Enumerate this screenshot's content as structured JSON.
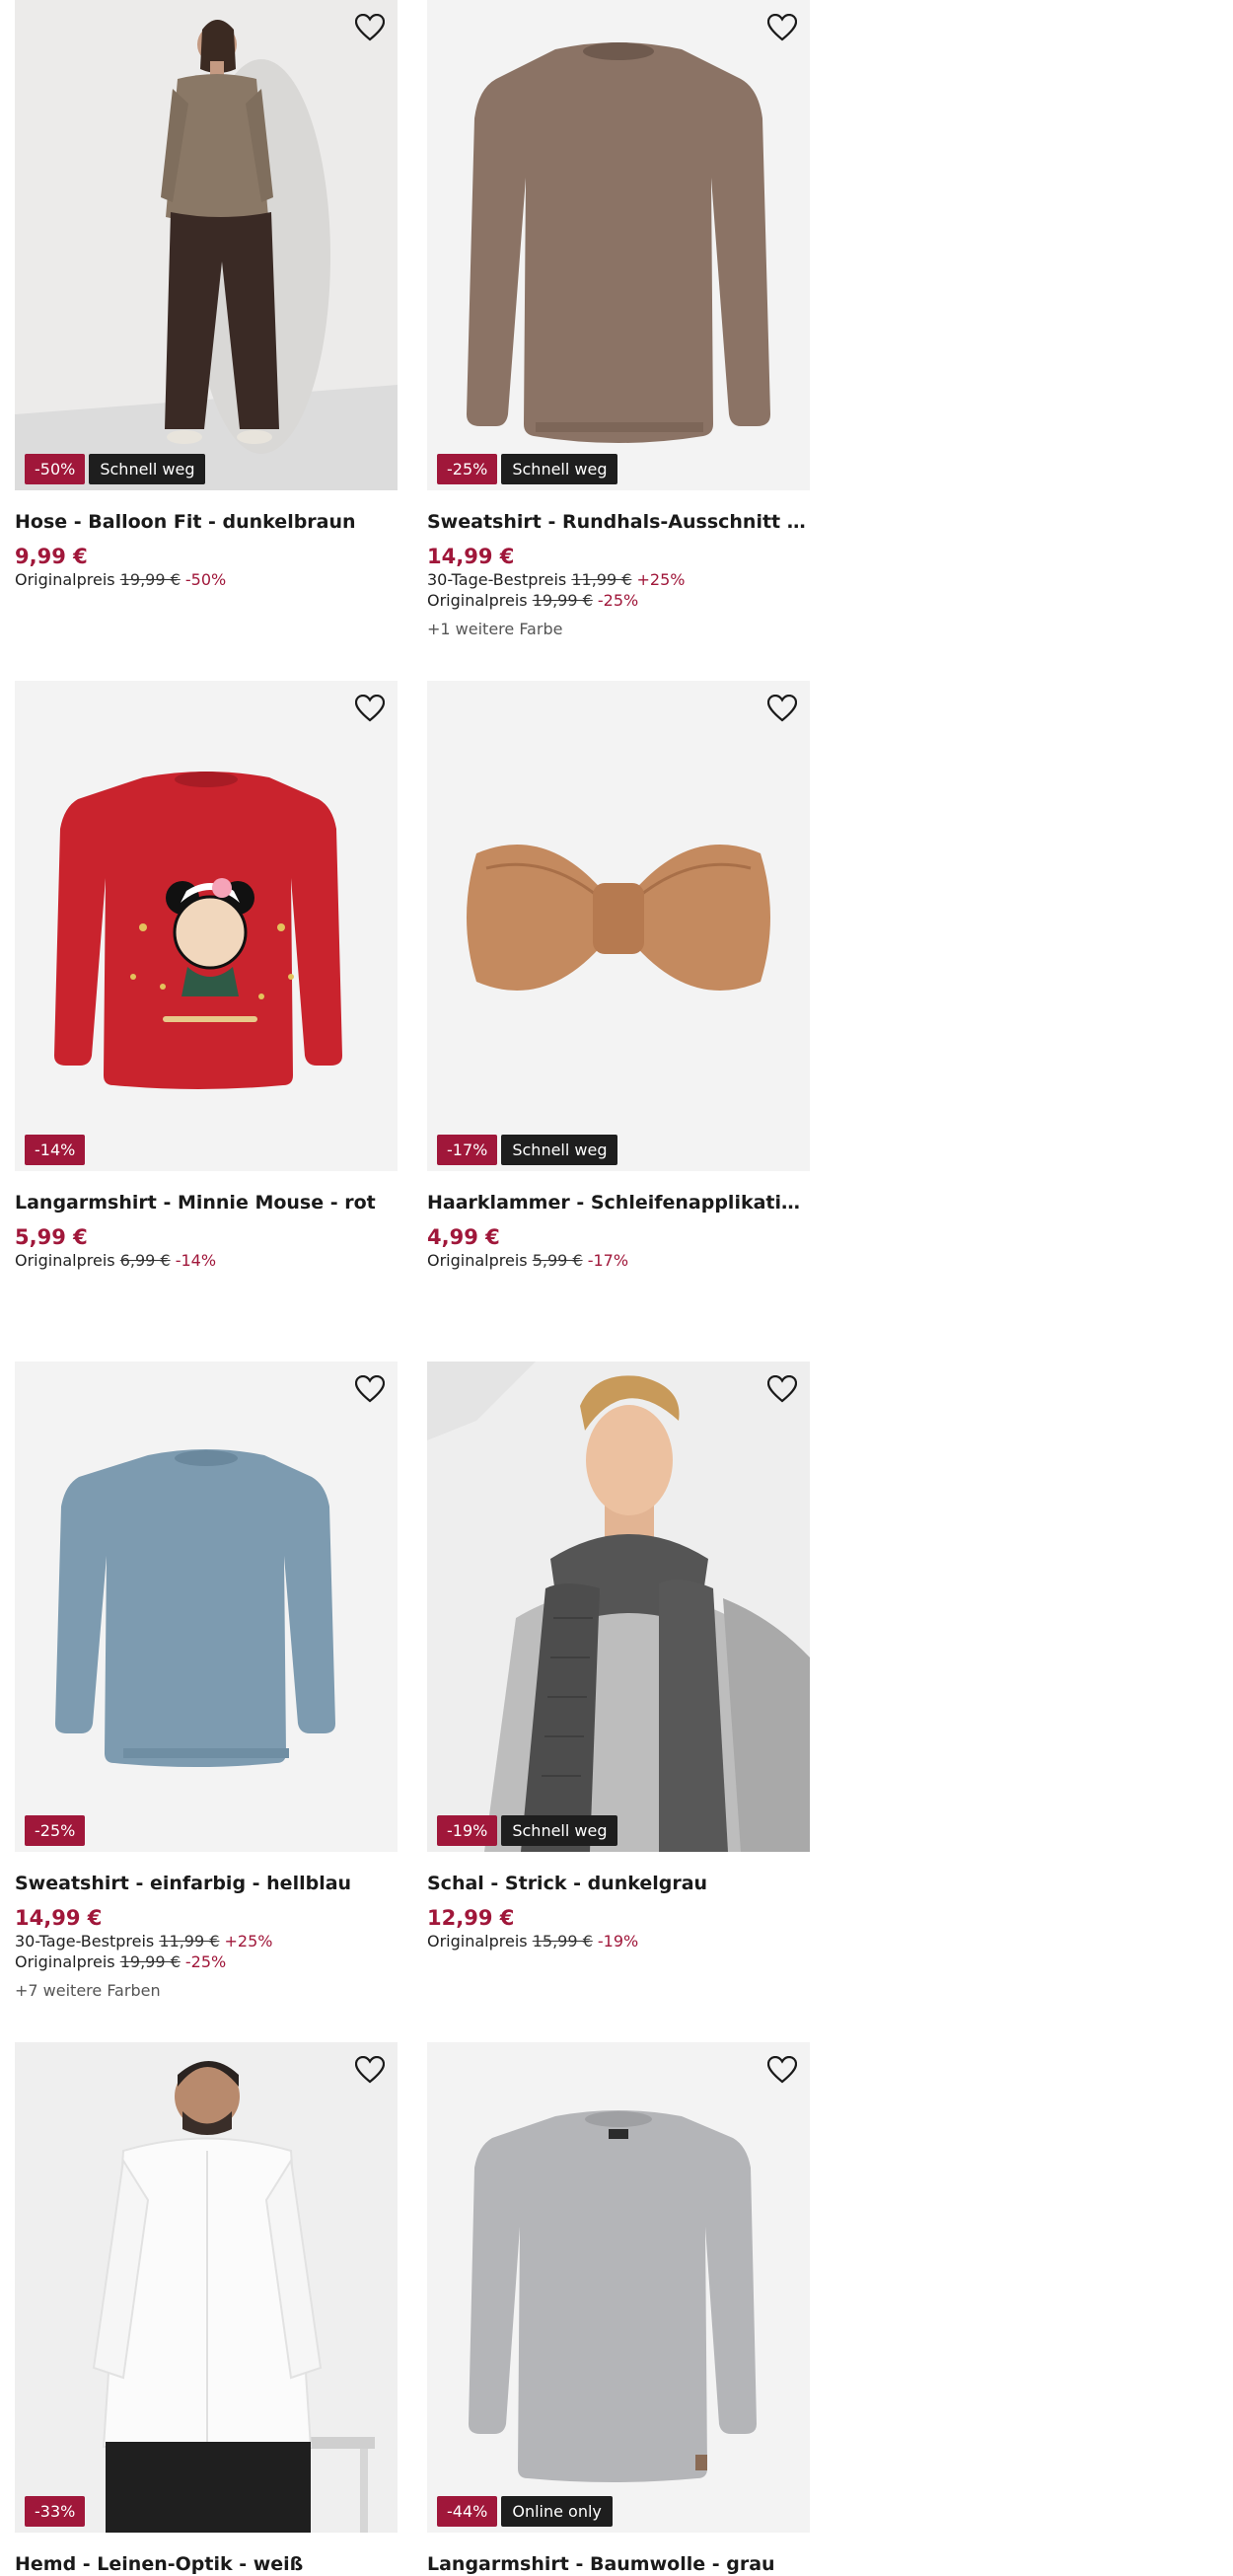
{
  "colors": {
    "accent": "#a0173a",
    "flag_bg": "#1e1e1e",
    "image_bg": "#f3f3f3"
  },
  "icons": {
    "wishlist": "heart-outline-icon"
  },
  "products": [
    {
      "title": "Hose - Balloon Fit - dunkelbraun",
      "price": "9,99 €",
      "discount_badge": "-50%",
      "flag_badge": "Schnell weg",
      "best_price": null,
      "original": {
        "label": "Originalpreis",
        "value": "19,99 €",
        "pct": "-50%"
      },
      "more_colors": null
    },
    {
      "title": "Sweatshirt - Rundhals-Ausschnitt - hellbraun",
      "price": "14,99 €",
      "discount_badge": "-25%",
      "flag_badge": "Schnell weg",
      "best_price": {
        "label": "30-Tage-Bestpreis",
        "value": "11,99 €",
        "pct": "+25%"
      },
      "original": {
        "label": "Originalpreis",
        "value": "19,99 €",
        "pct": "-25%"
      },
      "more_colors": "+1 weitere Farbe"
    },
    {
      "title": "Langarmshirt - Minnie Mouse - rot",
      "price": "5,99 €",
      "discount_badge": "-14%",
      "flag_badge": null,
      "best_price": null,
      "original": {
        "label": "Originalpreis",
        "value": "6,99 €",
        "pct": "-14%"
      },
      "more_colors": null
    },
    {
      "title": "Haarklammer - Schleifenapplikation - braun",
      "price": "4,99 €",
      "discount_badge": "-17%",
      "flag_badge": "Schnell weg",
      "best_price": null,
      "original": {
        "label": "Originalpreis",
        "value": "5,99 €",
        "pct": "-17%"
      },
      "more_colors": null
    },
    {
      "title": "Sweatshirt - einfarbig - hellblau",
      "price": "14,99 €",
      "discount_badge": "-25%",
      "flag_badge": null,
      "best_price": {
        "label": "30-Tage-Bestpreis",
        "value": "11,99 €",
        "pct": "+25%"
      },
      "original": {
        "label": "Originalpreis",
        "value": "19,99 €",
        "pct": "-25%"
      },
      "more_colors": "+7 weitere Farben"
    },
    {
      "title": "Schal - Strick - dunkelgrau",
      "price": "12,99 €",
      "discount_badge": "-19%",
      "flag_badge": "Schnell weg",
      "best_price": null,
      "original": {
        "label": "Originalpreis",
        "value": "15,99 €",
        "pct": "-19%"
      },
      "more_colors": null
    },
    {
      "title": "Hemd - Leinen-Optik - weiß",
      "price": "",
      "discount_badge": "-33%",
      "flag_badge": null,
      "best_price": null,
      "original": null,
      "more_colors": null
    },
    {
      "title": "Langarmshirt - Baumwolle - grau",
      "price": "",
      "discount_badge": "-44%",
      "flag_badge": "Online only",
      "best_price": null,
      "original": null,
      "more_colors": null
    }
  ]
}
